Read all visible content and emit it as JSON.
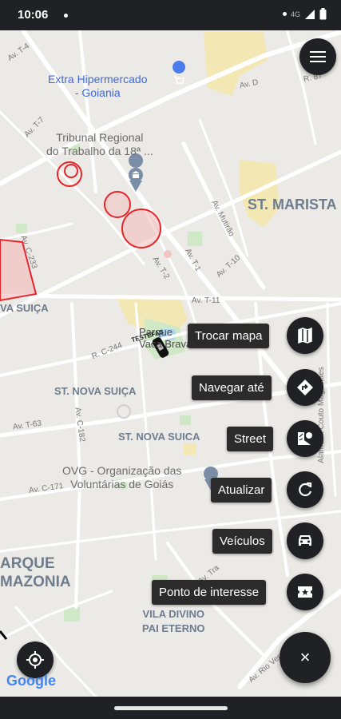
{
  "status_bar": {
    "time": "10:06",
    "network": "4G"
  },
  "map": {
    "places": [
      {
        "id": "extra",
        "text": "Extra Hipermercado\n- Goiania",
        "color": "#3f6ad8"
      },
      {
        "id": "tribunal",
        "text": "Tribunal Regional\ndo Trabalho da 18ª ...",
        "color": "#6b6b6b"
      },
      {
        "id": "ovg",
        "text": "OVG - Organização das\nVoluntárias de Goiás",
        "color": "#6b6b6b"
      },
      {
        "id": "parque",
        "text": "Parque\nVaca Brava",
        "color": "#4a4a4a"
      }
    ],
    "districts": [
      {
        "id": "st-marista",
        "text": "ST. MARISTA"
      },
      {
        "id": "nova-suica-1",
        "text": "ST. NOVA SUIÇA"
      },
      {
        "id": "nova-suica-2",
        "text": "ST. NOVA SUICA"
      },
      {
        "id": "nova-suica-left",
        "text": "VA SUIÇA"
      },
      {
        "id": "parque-amazonia",
        "text": "ARQUE\nMAZONIA"
      },
      {
        "id": "vila-divino",
        "text": "VILA DIVINO\nPAI ETERNO"
      }
    ],
    "streets": [
      {
        "id": "av-t4",
        "text": "Av. T-4"
      },
      {
        "id": "av-d",
        "text": "Av. D"
      },
      {
        "id": "r87",
        "text": "R. 87"
      },
      {
        "id": "av-t7",
        "text": "Av. T-7"
      },
      {
        "id": "av-mutirao",
        "text": "Av. Mutirão"
      },
      {
        "id": "av-t1",
        "text": "Av. T-1"
      },
      {
        "id": "av-t2",
        "text": "Av. T-2"
      },
      {
        "id": "av-t10",
        "text": "Av. T-10"
      },
      {
        "id": "av-t11",
        "text": "Av. T-11"
      },
      {
        "id": "av-c233",
        "text": "Av. C-233"
      },
      {
        "id": "r-c244",
        "text": "R. C-244"
      },
      {
        "id": "av-t63",
        "text": "Av. T-63"
      },
      {
        "id": "av-c182",
        "text": "Av. C-182"
      },
      {
        "id": "av-c171",
        "text": "Av. C-171"
      },
      {
        "id": "testefas",
        "text": "TESTEFAS"
      },
      {
        "id": "alameda",
        "text": "Alameda Couto Magalhães"
      },
      {
        "id": "av-rio-verde",
        "text": "Av. Rio Verde"
      },
      {
        "id": "av-tr",
        "text": "Av. Tra"
      }
    ],
    "attribution": "Google",
    "colors": {
      "road": "#ffffff",
      "block": "#eceae6",
      "park": "#cfe8c5",
      "commercial": "#f3e7b3",
      "zone_stroke": "#e8242a",
      "zone_fill": "#f3b9b9"
    }
  },
  "menu_button": {
    "icon": "menu-icon"
  },
  "fab_menu": {
    "items": [
      {
        "id": "trocar-mapa",
        "label": "Trocar mapa",
        "icon": "map-icon"
      },
      {
        "id": "navegar-ate",
        "label": "Navegar até",
        "icon": "directions-icon"
      },
      {
        "id": "street",
        "label": "Street",
        "icon": "street-view-icon"
      },
      {
        "id": "atualizar",
        "label": "Atualizar",
        "icon": "refresh-icon"
      },
      {
        "id": "veiculos",
        "label": "Veículos",
        "icon": "car-icon"
      },
      {
        "id": "ponto-interesse",
        "label": "Ponto de interesse",
        "icon": "poi-ticket-icon"
      }
    ],
    "close_label": "×"
  },
  "location_button": {
    "icon": "my-location-icon"
  }
}
